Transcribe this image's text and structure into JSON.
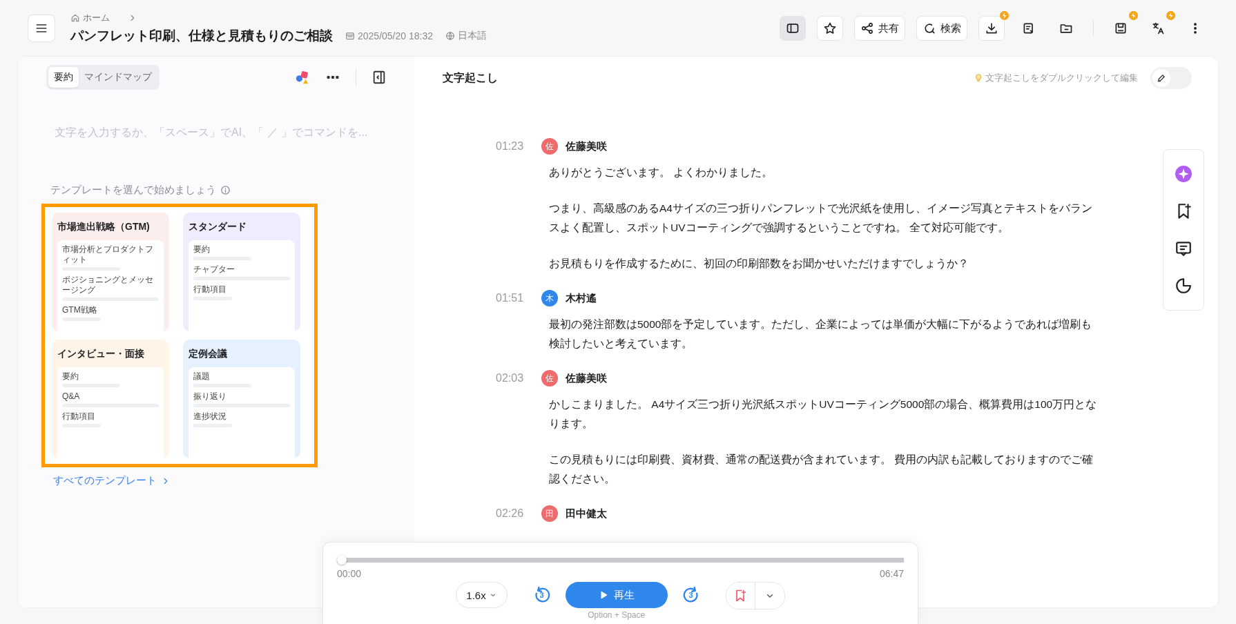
{
  "topbar": {
    "breadcrumb": "ホーム",
    "title": "パンフレット印刷、仕様と見積もりのご相談",
    "date": "2025/05/20 18:32",
    "language": "日本語",
    "toolbar": [
      {
        "selected": true,
        "badge": false
      },
      {
        "selected": false,
        "badge": false
      },
      {
        "label": "共有",
        "selected": false,
        "badge": false
      },
      {
        "label": "検索",
        "selected": false,
        "badge": false
      },
      {
        "selected": false,
        "badge": true
      },
      {
        "selected": false,
        "badge": false
      },
      {
        "selected": false,
        "badge": false
      },
      {
        "selected": false,
        "badge": true
      },
      {
        "selected": false,
        "badge": true
      },
      {
        "selected": false,
        "badge": false
      }
    ]
  },
  "summary": {
    "tabs": [
      {
        "label": "要約",
        "selected": true
      },
      {
        "label": "マインドマップ",
        "selected": false
      }
    ],
    "editor": {
      "placeholder": "文字を入力するか、「スペース」でAI、「 ／ 」でコマンドを..."
    },
    "templates_heading": "テンプレートを選んで始めましょう",
    "templates": [
      {
        "title": "市場進出戦略（GTM)",
        "color": "#fdeeee",
        "items": [
          "市場分析とプロダクトフィット",
          "ポジショニングとメッセージング",
          "GTM戦略"
        ]
      },
      {
        "title": "スタンダード",
        "color": "#f1ecfd",
        "items": [
          "要約",
          "チャプター",
          "行動項目"
        ]
      },
      {
        "title": "インタビュー・面接",
        "color": "#fef4e7",
        "items": [
          "要約",
          "Q&A",
          "行動項目"
        ]
      },
      {
        "title": "定例会議",
        "color": "#e6f1fe",
        "items": [
          "議題",
          "振り返り",
          "進捗状況"
        ]
      }
    ],
    "all_templates_link": "すべてのテンプレート"
  },
  "transcript": {
    "title": "文字起こし",
    "hint": "文字起こしをダブルクリックして編集",
    "edit_mode": false,
    "entries": [
      {
        "time": "01:23",
        "initial": "佐",
        "speaker": "佐藤美咲",
        "color": "#ee6b6e",
        "paragraphs": [
          "ありがとうございます。 よくわかりました。",
          "つまり、高級感のあるA4サイズの三つ折りパンフレットで光沢紙を使用し、イメージ写真とテキストをバランスよく配置し、スポットUVコーティングで強調するということですね。 全て対応可能です。",
          "お見積もりを作成するために、初回の印刷部数をお聞かせいただけますでしょうか？"
        ]
      },
      {
        "time": "01:51",
        "initial": "木",
        "speaker": "木村遙",
        "color": "#2f86eb",
        "paragraphs": [
          "最初の発注部数は5000部を予定しています。ただし、企業によっては単価が大幅に下がるようであれば増刷も検討したいと考えています。"
        ]
      },
      {
        "time": "02:03",
        "initial": "佐",
        "speaker": "佐藤美咲",
        "color": "#ee6b6e",
        "paragraphs": [
          "かしこまりました。 A4サイズ三つ折り光沢紙スポットUVコーティング5000部の場合、概算費用は100万円となります。",
          "この見積もりには印刷費、資材費、通常の配送費が含まれています。 費用の内訳も記載しておりますのでご確認ください。"
        ]
      },
      {
        "time": "02:26",
        "initial": "田",
        "speaker": "田中健太",
        "color": "#ee6b6e"
      }
    ]
  },
  "player": {
    "level": 0,
    "current": "00:00",
    "total": "06:47",
    "speed": "1.6x",
    "skip_back": "3",
    "skip_forward": "3",
    "play_label": "再生",
    "shortcut": "Option + Space"
  }
}
